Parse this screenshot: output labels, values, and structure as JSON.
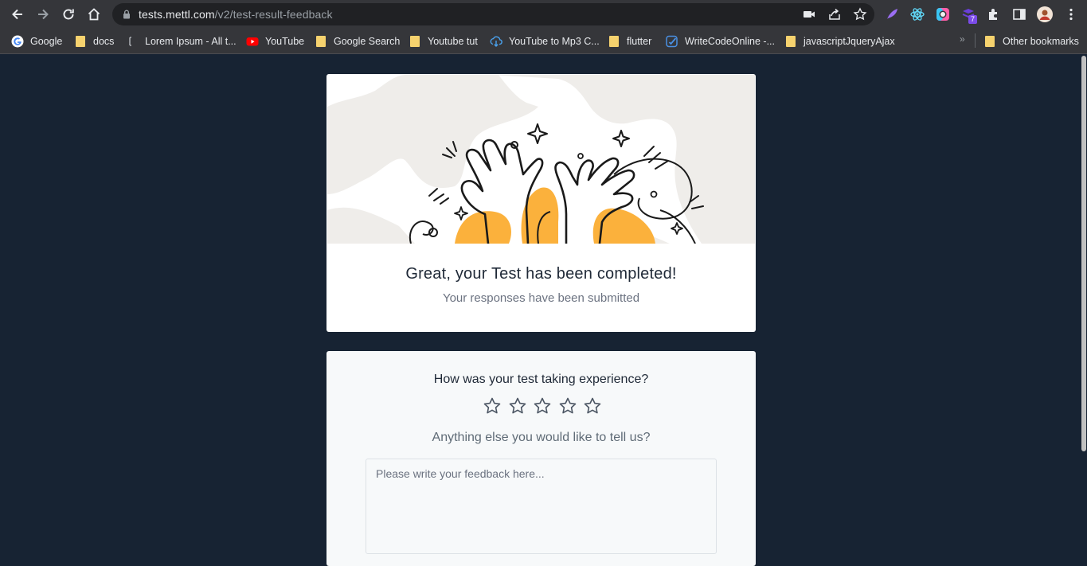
{
  "browser": {
    "url_host": "tests.mettl.com",
    "url_path": "/v2/test-result-feedback",
    "extension_badge": "7",
    "bookmarks": [
      {
        "label": "Google",
        "icon": "google-icon"
      },
      {
        "label": "docs",
        "icon": "folder-icon"
      },
      {
        "label": "Lorem Ipsum - All t...",
        "icon": "lorem-icon"
      },
      {
        "label": "YouTube",
        "icon": "youtube-icon"
      },
      {
        "label": "Google Search",
        "icon": "folder-icon"
      },
      {
        "label": "Youtube tut",
        "icon": "folder-icon"
      },
      {
        "label": "YouTube to Mp3 C...",
        "icon": "download-icon"
      },
      {
        "label": "flutter",
        "icon": "folder-icon"
      },
      {
        "label": "WriteCodeOnline -...",
        "icon": "writecode-icon"
      },
      {
        "label": "javascriptJqueryAjax",
        "icon": "folder-icon"
      }
    ],
    "more_bookmarks": "»",
    "other_bookmarks": "Other bookmarks"
  },
  "result": {
    "title": "Great, your Test has been completed!",
    "subtitle": "Your responses have been submitted"
  },
  "feedback": {
    "rating_question": "How was your test taking experience?",
    "rating_max": 5,
    "rating_value": 0,
    "comment_question": "Anything else you would like to tell us?",
    "comment_placeholder": "Please write your feedback here...",
    "comment_value": ""
  },
  "colors": {
    "page_bg": "#172333",
    "accent_orange": "#fbb13c",
    "hero_shapes": "#efedea"
  }
}
